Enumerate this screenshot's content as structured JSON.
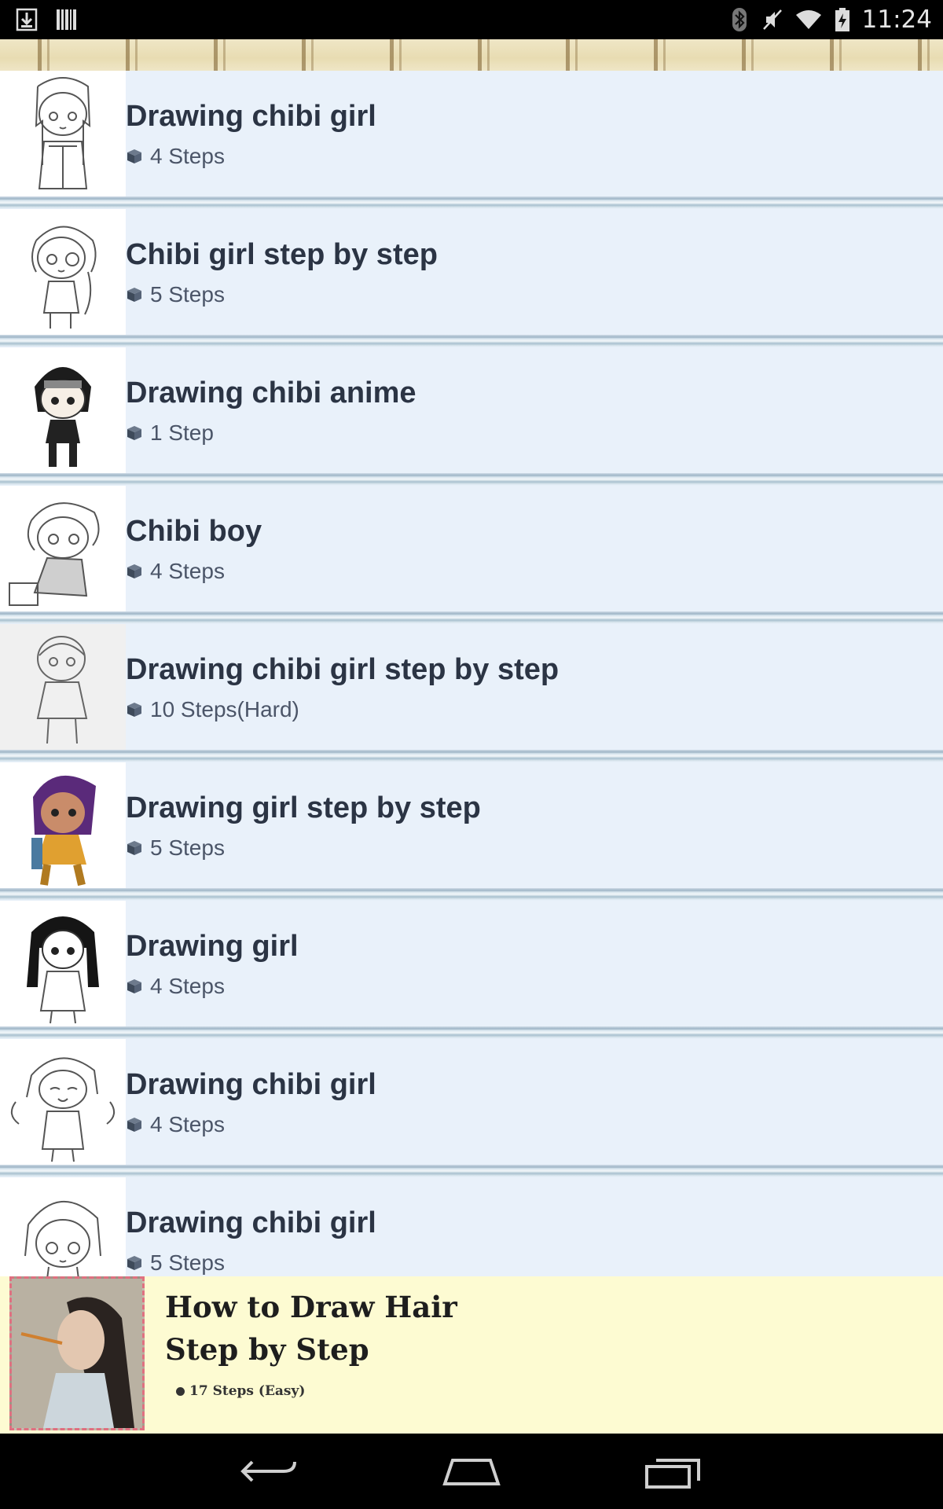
{
  "status_bar": {
    "left_icons": [
      "download-icon",
      "barcode-icon"
    ],
    "right_icons": [
      "bluetooth-icon",
      "vibrate-mute-icon",
      "wifi-icon",
      "battery-icon"
    ],
    "time": "11:24"
  },
  "list": {
    "items": [
      {
        "title": "Drawing chibi girl",
        "steps": "4 Steps"
      },
      {
        "title": "Chibi girl step by step",
        "steps": "5 Steps"
      },
      {
        "title": "Drawing chibi anime",
        "steps": "1 Step"
      },
      {
        "title": "Chibi boy",
        "steps": "4 Steps"
      },
      {
        "title": "Drawing chibi girl step by step",
        "steps": "10 Steps(Hard)"
      },
      {
        "title": "Drawing girl step by step",
        "steps": "5 Steps"
      },
      {
        "title": "Drawing girl",
        "steps": "4 Steps"
      },
      {
        "title": "Drawing chibi girl",
        "steps": "4 Steps"
      },
      {
        "title": "Drawing chibi girl",
        "steps": "5 Steps"
      }
    ]
  },
  "ad": {
    "title_line1": "How to Draw Hair",
    "title_line2": "Step by Step",
    "steps": "17 Steps (Easy)"
  },
  "nav": {
    "icons": [
      "back-icon",
      "home-icon",
      "recent-apps-icon"
    ]
  },
  "colors": {
    "list_bg": "#e9f1fa",
    "title": "#2b3444",
    "ad_bg": "#fdfbd2"
  }
}
